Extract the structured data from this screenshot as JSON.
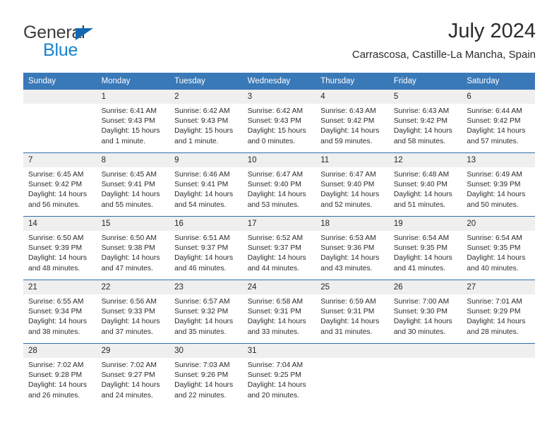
{
  "brand": {
    "line1": "General",
    "line2": "Blue",
    "accent_blue": "#1783d2",
    "triangle_blue": "#1268b3"
  },
  "header": {
    "title": "July 2024",
    "subtitle": "Carrascosa, Castille-La Mancha, Spain"
  },
  "theme": {
    "header_bg": "#3a79b8",
    "row_divider": "#2f6fae",
    "daynum_bg": "#efefef"
  },
  "weekday_headers": [
    "Sunday",
    "Monday",
    "Tuesday",
    "Wednesday",
    "Thursday",
    "Friday",
    "Saturday"
  ],
  "weeks": [
    [
      {
        "day": "",
        "sunrise": "",
        "sunset": "",
        "daylight": "",
        "empty": true
      },
      {
        "day": "1",
        "sunrise": "Sunrise: 6:41 AM",
        "sunset": "Sunset: 9:43 PM",
        "daylight": "Daylight: 15 hours and 1 minute."
      },
      {
        "day": "2",
        "sunrise": "Sunrise: 6:42 AM",
        "sunset": "Sunset: 9:43 PM",
        "daylight": "Daylight: 15 hours and 1 minute."
      },
      {
        "day": "3",
        "sunrise": "Sunrise: 6:42 AM",
        "sunset": "Sunset: 9:43 PM",
        "daylight": "Daylight: 15 hours and 0 minutes."
      },
      {
        "day": "4",
        "sunrise": "Sunrise: 6:43 AM",
        "sunset": "Sunset: 9:42 PM",
        "daylight": "Daylight: 14 hours and 59 minutes."
      },
      {
        "day": "5",
        "sunrise": "Sunrise: 6:43 AM",
        "sunset": "Sunset: 9:42 PM",
        "daylight": "Daylight: 14 hours and 58 minutes."
      },
      {
        "day": "6",
        "sunrise": "Sunrise: 6:44 AM",
        "sunset": "Sunset: 9:42 PM",
        "daylight": "Daylight: 14 hours and 57 minutes."
      }
    ],
    [
      {
        "day": "7",
        "sunrise": "Sunrise: 6:45 AM",
        "sunset": "Sunset: 9:42 PM",
        "daylight": "Daylight: 14 hours and 56 minutes."
      },
      {
        "day": "8",
        "sunrise": "Sunrise: 6:45 AM",
        "sunset": "Sunset: 9:41 PM",
        "daylight": "Daylight: 14 hours and 55 minutes."
      },
      {
        "day": "9",
        "sunrise": "Sunrise: 6:46 AM",
        "sunset": "Sunset: 9:41 PM",
        "daylight": "Daylight: 14 hours and 54 minutes."
      },
      {
        "day": "10",
        "sunrise": "Sunrise: 6:47 AM",
        "sunset": "Sunset: 9:40 PM",
        "daylight": "Daylight: 14 hours and 53 minutes."
      },
      {
        "day": "11",
        "sunrise": "Sunrise: 6:47 AM",
        "sunset": "Sunset: 9:40 PM",
        "daylight": "Daylight: 14 hours and 52 minutes."
      },
      {
        "day": "12",
        "sunrise": "Sunrise: 6:48 AM",
        "sunset": "Sunset: 9:40 PM",
        "daylight": "Daylight: 14 hours and 51 minutes."
      },
      {
        "day": "13",
        "sunrise": "Sunrise: 6:49 AM",
        "sunset": "Sunset: 9:39 PM",
        "daylight": "Daylight: 14 hours and 50 minutes."
      }
    ],
    [
      {
        "day": "14",
        "sunrise": "Sunrise: 6:50 AM",
        "sunset": "Sunset: 9:39 PM",
        "daylight": "Daylight: 14 hours and 48 minutes."
      },
      {
        "day": "15",
        "sunrise": "Sunrise: 6:50 AM",
        "sunset": "Sunset: 9:38 PM",
        "daylight": "Daylight: 14 hours and 47 minutes."
      },
      {
        "day": "16",
        "sunrise": "Sunrise: 6:51 AM",
        "sunset": "Sunset: 9:37 PM",
        "daylight": "Daylight: 14 hours and 46 minutes."
      },
      {
        "day": "17",
        "sunrise": "Sunrise: 6:52 AM",
        "sunset": "Sunset: 9:37 PM",
        "daylight": "Daylight: 14 hours and 44 minutes."
      },
      {
        "day": "18",
        "sunrise": "Sunrise: 6:53 AM",
        "sunset": "Sunset: 9:36 PM",
        "daylight": "Daylight: 14 hours and 43 minutes."
      },
      {
        "day": "19",
        "sunrise": "Sunrise: 6:54 AM",
        "sunset": "Sunset: 9:35 PM",
        "daylight": "Daylight: 14 hours and 41 minutes."
      },
      {
        "day": "20",
        "sunrise": "Sunrise: 6:54 AM",
        "sunset": "Sunset: 9:35 PM",
        "daylight": "Daylight: 14 hours and 40 minutes."
      }
    ],
    [
      {
        "day": "21",
        "sunrise": "Sunrise: 6:55 AM",
        "sunset": "Sunset: 9:34 PM",
        "daylight": "Daylight: 14 hours and 38 minutes."
      },
      {
        "day": "22",
        "sunrise": "Sunrise: 6:56 AM",
        "sunset": "Sunset: 9:33 PM",
        "daylight": "Daylight: 14 hours and 37 minutes."
      },
      {
        "day": "23",
        "sunrise": "Sunrise: 6:57 AM",
        "sunset": "Sunset: 9:32 PM",
        "daylight": "Daylight: 14 hours and 35 minutes."
      },
      {
        "day": "24",
        "sunrise": "Sunrise: 6:58 AM",
        "sunset": "Sunset: 9:31 PM",
        "daylight": "Daylight: 14 hours and 33 minutes."
      },
      {
        "day": "25",
        "sunrise": "Sunrise: 6:59 AM",
        "sunset": "Sunset: 9:31 PM",
        "daylight": "Daylight: 14 hours and 31 minutes."
      },
      {
        "day": "26",
        "sunrise": "Sunrise: 7:00 AM",
        "sunset": "Sunset: 9:30 PM",
        "daylight": "Daylight: 14 hours and 30 minutes."
      },
      {
        "day": "27",
        "sunrise": "Sunrise: 7:01 AM",
        "sunset": "Sunset: 9:29 PM",
        "daylight": "Daylight: 14 hours and 28 minutes."
      }
    ],
    [
      {
        "day": "28",
        "sunrise": "Sunrise: 7:02 AM",
        "sunset": "Sunset: 9:28 PM",
        "daylight": "Daylight: 14 hours and 26 minutes."
      },
      {
        "day": "29",
        "sunrise": "Sunrise: 7:02 AM",
        "sunset": "Sunset: 9:27 PM",
        "daylight": "Daylight: 14 hours and 24 minutes."
      },
      {
        "day": "30",
        "sunrise": "Sunrise: 7:03 AM",
        "sunset": "Sunset: 9:26 PM",
        "daylight": "Daylight: 14 hours and 22 minutes."
      },
      {
        "day": "31",
        "sunrise": "Sunrise: 7:04 AM",
        "sunset": "Sunset: 9:25 PM",
        "daylight": "Daylight: 14 hours and 20 minutes."
      },
      {
        "day": "",
        "sunrise": "",
        "sunset": "",
        "daylight": "",
        "empty": true
      },
      {
        "day": "",
        "sunrise": "",
        "sunset": "",
        "daylight": "",
        "empty": true
      },
      {
        "day": "",
        "sunrise": "",
        "sunset": "",
        "daylight": "",
        "empty": true
      }
    ]
  ]
}
